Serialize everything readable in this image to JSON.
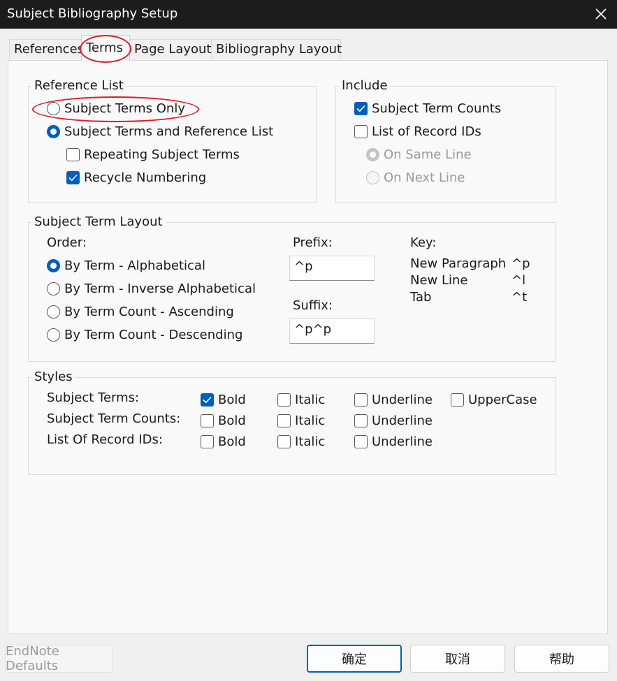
{
  "window": {
    "title": "Subject Bibliography Setup"
  },
  "tabs": [
    "References",
    "Terms",
    "Page Layout",
    "Bibliography Layout"
  ],
  "reference_list": {
    "label": "Reference List",
    "subject_terms_only": "Subject Terms Only",
    "subject_terms_and_reference_list": "Subject Terms and Reference List",
    "repeating_subject_terms": "Repeating Subject Terms",
    "recycle_numbering": "Recycle Numbering"
  },
  "include": {
    "label": "Include",
    "subject_term_counts": "Subject Term Counts",
    "list_of_record_ids": "List of Record IDs",
    "on_same_line": "On Same Line",
    "on_next_line": "On Next Line"
  },
  "layout": {
    "label": "Subject Term Layout",
    "order_label": "Order:",
    "order_options": [
      "By Term - Alphabetical",
      "By Term - Inverse Alphabetical",
      "By Term Count - Ascending",
      "By Term Count - Descending"
    ],
    "prefix_label": "Prefix:",
    "prefix_value": "^p",
    "suffix_label": "Suffix:",
    "suffix_value": "^p^p",
    "key_label": "Key:",
    "keys": [
      {
        "name": "New Paragraph",
        "code": "^p"
      },
      {
        "name": "New Line",
        "code": "^l"
      },
      {
        "name": "Tab",
        "code": "^t"
      }
    ]
  },
  "styles": {
    "label": "Styles",
    "rows": [
      "Subject Terms:",
      "Subject Term Counts:",
      "List Of Record IDs:"
    ],
    "bold": "Bold",
    "italic": "Italic",
    "underline": "Underline",
    "uppercase": "UpperCase"
  },
  "buttons": {
    "endnote_defaults": "EndNote Defaults",
    "ok": "确定",
    "cancel": "取消",
    "help": "帮助"
  },
  "colors": {
    "accent": "#005fb8",
    "annotation": "#e01b24",
    "titlebar": "#1c1c1c"
  }
}
